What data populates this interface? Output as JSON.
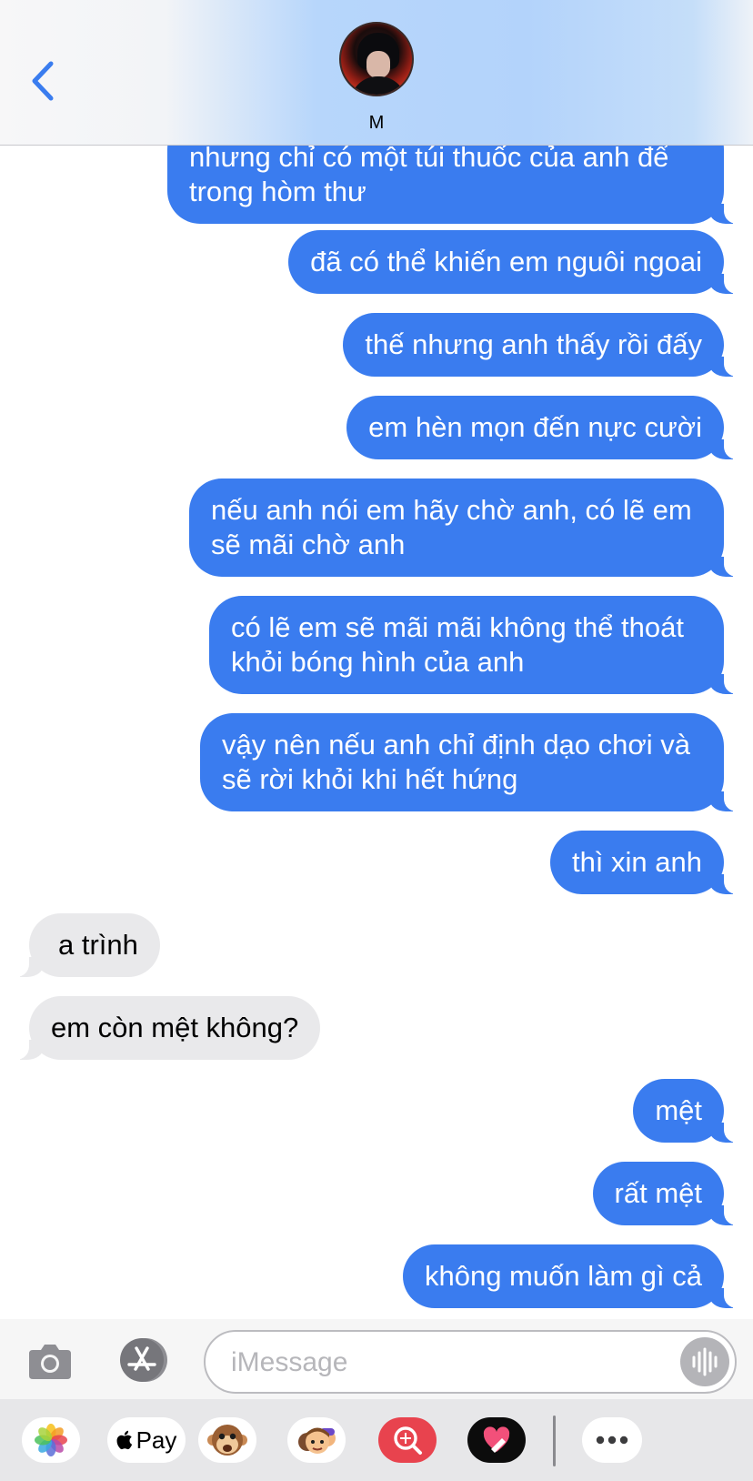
{
  "header": {
    "contact_name": "M",
    "back_icon": "chevron-left-icon",
    "accent_color": "#3a7cef"
  },
  "messages": [
    {
      "side": "sent",
      "text": "nhưng chỉ có một túi thuốc của anh để\ntrong hòm thư",
      "partial": true
    },
    {
      "side": "sent",
      "text": "đã có thể khiến em nguôi ngoai"
    },
    {
      "side": "sent",
      "text": "thế nhưng anh thấy rồi đấy"
    },
    {
      "side": "sent",
      "text": "em hèn mọn đến nực cười"
    },
    {
      "side": "sent",
      "text": "nếu anh nói em hãy chờ anh, có lẽ em\nsẽ mãi chờ anh"
    },
    {
      "side": "sent",
      "text": "có lẽ em sẽ mãi mãi không thể thoát\nkhỏi bóng hình của anh"
    },
    {
      "side": "sent",
      "text": "vậy nên nếu anh chỉ định dạo chơi và\nsẽ rời khỏi khi hết hứng"
    },
    {
      "side": "sent",
      "text": "thì xin anh"
    },
    {
      "side": "received",
      "text": "a trình"
    },
    {
      "side": "received",
      "text": "em còn mệt không?"
    },
    {
      "side": "sent",
      "text": "mệt"
    },
    {
      "side": "sent",
      "text": "rất mệt"
    },
    {
      "side": "sent",
      "text": "không muốn làm gì cả"
    }
  ],
  "input_bar": {
    "placeholder": "iMessage",
    "value": "",
    "camera_icon": "camera-icon",
    "appstore_icon": "app-store-icon",
    "audio_icon": "audio-waveform-icon"
  },
  "app_drawer": {
    "apps": [
      {
        "name": "Photos",
        "icon": "photos-icon"
      },
      {
        "name": "Apple Pay",
        "label": "Pay",
        "icon": "apple-pay-icon"
      },
      {
        "name": "Animoji",
        "icon": "monkey-animoji-icon"
      },
      {
        "name": "Memoji",
        "icon": "memoji-icon"
      },
      {
        "name": "Images",
        "icon": "image-search-icon"
      },
      {
        "name": "Digital Touch",
        "icon": "digital-touch-icon"
      },
      {
        "name": "More",
        "icon": "more-icon"
      }
    ]
  }
}
